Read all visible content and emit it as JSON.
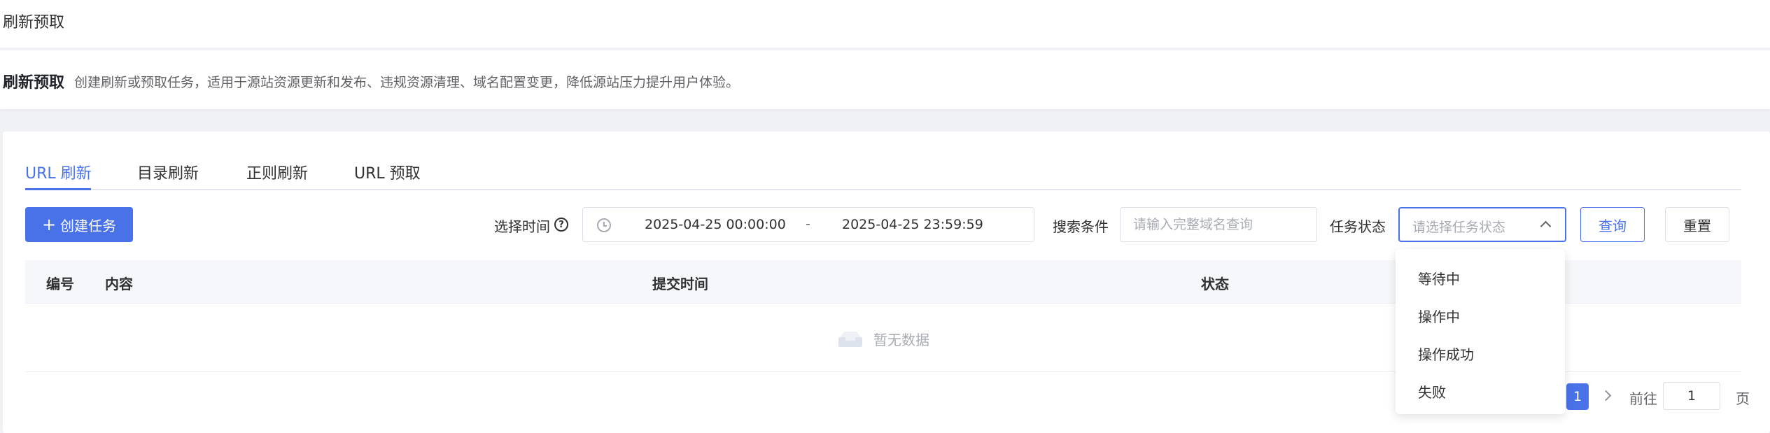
{
  "breadcrumb": "刷新预取",
  "description": {
    "title": "刷新预取",
    "text": "创建刷新或预取任务，适用于源站资源更新和发布、违规资源清理、域名配置变更，降低源站压力提升用户体验。"
  },
  "tabs": [
    {
      "label": "URL 刷新",
      "active": true
    },
    {
      "label": "目录刷新",
      "active": false
    },
    {
      "label": "正则刷新",
      "active": false
    },
    {
      "label": "URL 预取",
      "active": false
    }
  ],
  "toolbar": {
    "create_label": "创建任务",
    "time_label": "选择时间",
    "date_start": "2025-04-25 00:00:00",
    "date_sep": "-",
    "date_end": "2025-04-25 23:59:59",
    "search_label": "搜索条件",
    "search_placeholder": "请输入完整域名查询",
    "status_label": "任务状态",
    "status_placeholder": "请选择任务状态",
    "query_label": "查询",
    "reset_label": "重置"
  },
  "table": {
    "columns": [
      "编号",
      "内容",
      "提交时间",
      "状态"
    ],
    "empty_text": "暂无数据"
  },
  "pagination": {
    "dots": "⋮",
    "current_page": "1",
    "goto_label": "前往",
    "goto_value": "1",
    "goto_unit": "页"
  },
  "status_options": [
    "等待中",
    "操作中",
    "操作成功",
    "失败"
  ],
  "colors": {
    "primary": "#4a72e8",
    "border": "#dcdfe6",
    "placeholder": "#a8abb2"
  }
}
